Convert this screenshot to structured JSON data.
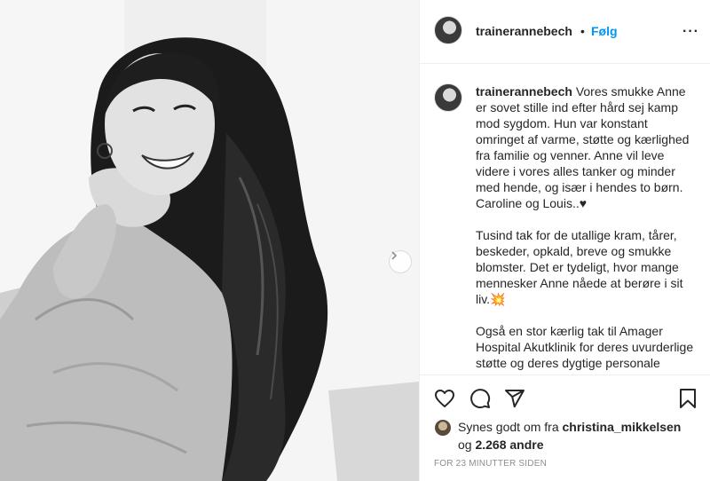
{
  "post": {
    "username": "trainerannebech",
    "separator": "•",
    "follow_label": "Følg",
    "more_label": "···"
  },
  "caption": {
    "username": "trainerannebech",
    "paragraph1": "Vores smukke Anne er sovet stille ind efter hård sej kamp mod sygdom. Hun var konstant omringet af varme, støtte og kærlighed fra familie og venner. Anne vil leve videre i vores alles tanker og minder med hende, og især i hendes to børn. Caroline og Louis..♥",
    "paragraph2": "Tusind tak for de utallige kram, tårer, beskeder, opkald, breve og smukke blomster. Det er tydeligt, hvor mange mennesker Anne nåede at berøre i sit liv.💥",
    "paragraph3": "Også en stor kærlig tak til Amager Hospital Akutklinik for deres uvurderlige støtte og deres dygtige personale fagfolk og hjælp"
  },
  "likes": {
    "prefix": "Synes godt om fra",
    "user": "christina_mikkelsen",
    "connector": "og",
    "count": "2.268 andre"
  },
  "timestamp": "FOR 23 MINUTTER SIDEN",
  "icons": [
    "heart-icon",
    "comment-icon",
    "share-icon",
    "bookmark-icon",
    "chevron-right-icon"
  ]
}
